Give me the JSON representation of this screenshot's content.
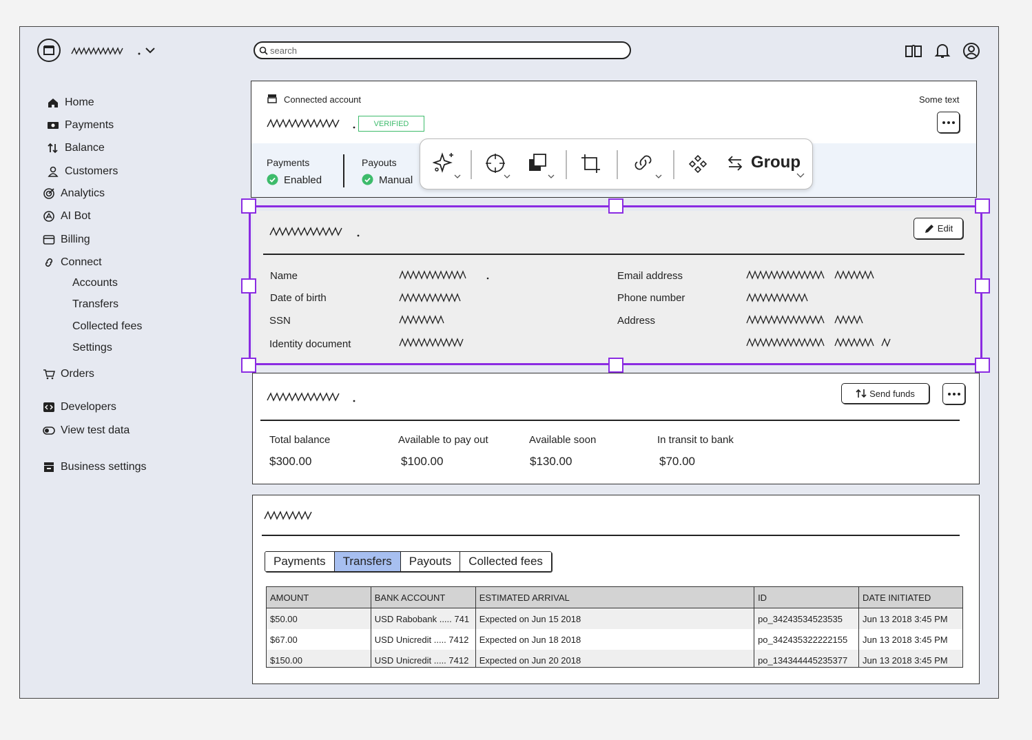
{
  "search": {
    "placeholder": "search"
  },
  "sidebar": {
    "items": [
      {
        "label": "Home",
        "icon": "home-icon"
      },
      {
        "label": "Payments",
        "icon": "payments-icon"
      },
      {
        "label": "Balance",
        "icon": "balance-icon"
      },
      {
        "label": "Customers",
        "icon": "customers-icon"
      },
      {
        "label": "Analytics",
        "icon": "analytics-icon"
      },
      {
        "label": "AI Bot",
        "icon": "ai-bot-icon"
      },
      {
        "label": "Billing",
        "icon": "billing-icon"
      },
      {
        "label": "Connect",
        "icon": "connect-icon"
      }
    ],
    "connect_sub": [
      "Accounts",
      "Transfers",
      "Collected fees",
      "Settings"
    ],
    "orders": "Orders",
    "developers": "Developers",
    "view_test_data": "View test data",
    "business_settings": "Business settings"
  },
  "account_card": {
    "connected_label": "Connected account",
    "some_text": "Some text",
    "badge": "VERIFIED",
    "badge_color": "#3dbb6b",
    "payments_label": "Payments",
    "payments_status": "Enabled",
    "payouts_label": "Payouts",
    "payouts_status": "Manual"
  },
  "toolbar": {
    "group_label": "Group"
  },
  "profile_card": {
    "edit_label": "Edit",
    "fields_left": [
      "Name",
      "Date of birth",
      "SSN",
      "Identity document"
    ],
    "fields_right": [
      "Email address",
      "Phone number",
      "Address"
    ],
    "selection_color": "#8a2be2"
  },
  "balance_card": {
    "send_funds_label": "Send funds",
    "stats": [
      {
        "label": "Total balance",
        "value": "$300.00"
      },
      {
        "label": "Available to pay out",
        "value": "$100.00"
      },
      {
        "label": "Available soon",
        "value": "$130.00"
      },
      {
        "label": "In transit to bank",
        "value": "$70.00"
      }
    ]
  },
  "activity_card": {
    "tabs": [
      "Payments",
      "Transfers",
      "Payouts",
      "Collected fees"
    ],
    "active_tab": "Transfers",
    "columns": [
      "AMOUNT",
      "BANK ACCOUNT",
      "ESTIMATED ARRIVAL",
      "ID",
      "DATE INITIATED"
    ],
    "rows": [
      [
        "$50.00",
        "USD Rabobank ..... 741",
        "Expected on Jun 15 2018",
        "po_34243534523535",
        "Jun 13 2018 3:45 PM"
      ],
      [
        "$67.00",
        "USD Unicredit ..... 7412",
        "Expected on Jun 18 2018",
        "po_342435322222155",
        "Jun 13 2018 3:45 PM"
      ],
      [
        "$150.00",
        "USD Unicredit ..... 7412",
        "Expected on Jun 20 2018",
        "po_134344445235377",
        "Jun 13 2018 3:45 PM"
      ]
    ]
  }
}
